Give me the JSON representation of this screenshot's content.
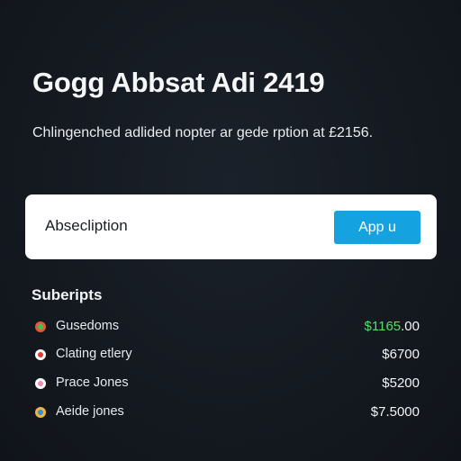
{
  "header": {
    "title": "Gogg Abbsat Adi 2419",
    "subtitle": "Chlingenched adlided nopter ar gede rption at £2156."
  },
  "search": {
    "value": "Absecliption",
    "button_label": "App u"
  },
  "subscriptions": {
    "title": "Suberipts",
    "items": [
      {
        "label": "Gusedoms",
        "amount_highlight": "$1165",
        "amount_rest": ".00",
        "icon": "green-status-icon",
        "colors": {
          "outer": "#e05a3a",
          "inner": "#3cc552"
        }
      },
      {
        "label": "Clating etlery",
        "amount_highlight": "",
        "amount_rest": "$6700",
        "icon": "red-status-icon",
        "colors": {
          "outer": "#ffffff",
          "inner": "#e23b2e"
        }
      },
      {
        "label": "Prace Jones",
        "amount_highlight": "",
        "amount_rest": "$5200",
        "icon": "pink-status-icon",
        "colors": {
          "outer": "#ffffff",
          "inner": "#f28bb4"
        }
      },
      {
        "label": "Aeide jones",
        "amount_highlight": "",
        "amount_rest": "$7.5000",
        "icon": "blue-status-icon",
        "colors": {
          "outer": "#f2b33a",
          "inner": "#2f8fe0"
        }
      }
    ]
  },
  "colors": {
    "background": "#141920",
    "accent": "#14a2e0",
    "positive": "#4ee06a"
  }
}
